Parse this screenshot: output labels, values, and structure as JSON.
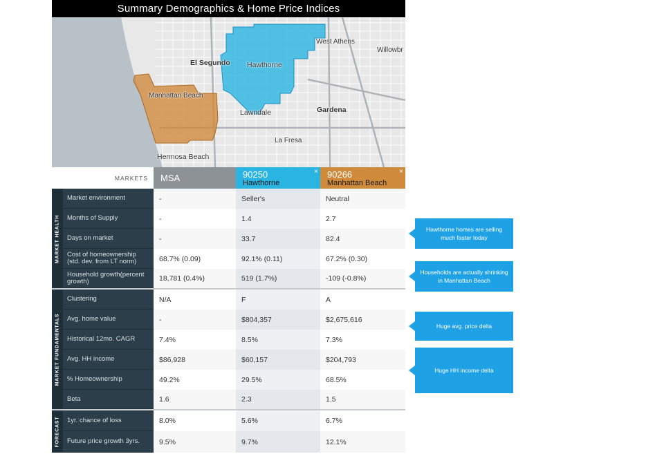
{
  "title": "Summary Demographics & Home Price Indices",
  "map": {
    "labels": {
      "west_athens": "West Athens",
      "willowbrook": "Willowbr",
      "el_segundo": "El Segundo",
      "hawthorne": "Hawthorne",
      "manhattan_beach": "Manhattan Beach",
      "lawndale": "Lawndale",
      "gardena": "Gardena",
      "la_fresa": "La Fresa",
      "hermosa_beach": "Hermosa Beach"
    },
    "colors": {
      "ocean": "#b9c1c8",
      "land": "#e8e8e8",
      "hawthorne": "#29b4e2",
      "manhattan": "#cf8a3c"
    }
  },
  "table": {
    "markets_label": "MARKETS",
    "columns": {
      "msa": {
        "label": "MSA"
      },
      "hawthorne": {
        "zip": "90250",
        "name": "Hawthorne",
        "close": "×"
      },
      "manhattan": {
        "zip": "90266",
        "name": "Manhattan Beach",
        "close": "×"
      }
    },
    "sections": {
      "market_health": "MARKET HEALTH",
      "market_fundamentals": "MARKET FUNDAMENTALS",
      "forecast": "FORECAST"
    },
    "rows": [
      {
        "label": "Market environment",
        "msa": "-",
        "haw": "Seller's",
        "mb": "Neutral"
      },
      {
        "label": "Months of Supply",
        "msa": "-",
        "haw": "1.4",
        "mb": "2.7"
      },
      {
        "label": "Days on market",
        "msa": "-",
        "haw": "33.7",
        "mb": "82.4"
      },
      {
        "label": "Cost of homeownership (std. dev. from LT norm)",
        "msa": "68.7% (0.09)",
        "haw": "92.1% (0.11)",
        "mb": "67.2% (0.30)"
      },
      {
        "label": "Household growth(percent growth)",
        "msa": "18,781 (0.4%)",
        "haw": "519 (1.7%)",
        "mb": "-109 (-0.8%)"
      },
      {
        "label": "Clustering",
        "msa": "N/A",
        "haw": "F",
        "mb": "A"
      },
      {
        "label": "Avg. home value",
        "msa": "-",
        "haw": "$804,357",
        "mb": "$2,675,616"
      },
      {
        "label": "Historical 12mo. CAGR",
        "msa": "7.4%",
        "haw": "8.5%",
        "mb": "7.3%"
      },
      {
        "label": "Avg. HH income",
        "msa": "$86,928",
        "haw": "$60,157",
        "mb": "$204,793"
      },
      {
        "label": "% Homeownership",
        "msa": "49.2%",
        "haw": "29.5%",
        "mb": "68.5%"
      },
      {
        "label": "Beta",
        "msa": "1.6",
        "haw": "2.3",
        "mb": "1.5"
      },
      {
        "label": "1yr. chance of loss",
        "msa": "8.0%",
        "haw": "5.6%",
        "mb": "6.7%"
      },
      {
        "label": "Future price growth 3yrs.",
        "msa": "9.5%",
        "haw": "9.7%",
        "mb": "12.1%"
      }
    ]
  },
  "callouts": [
    "Hawthorne homes are selling much faster today",
    "Households are actually shrinking in Manhattan Beach",
    "Huge avg. price delta",
    "Huge HH income delta"
  ]
}
